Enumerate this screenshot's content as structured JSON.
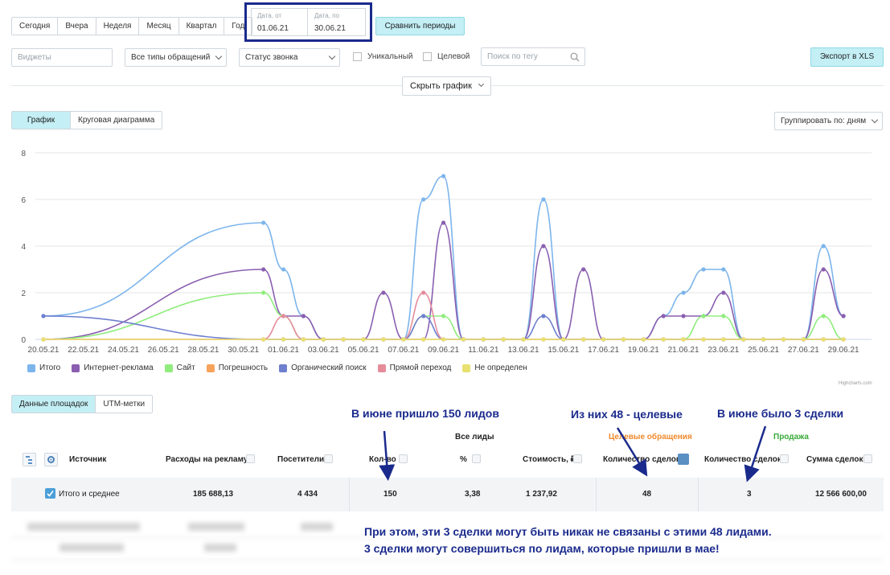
{
  "periods": [
    "Сегодня",
    "Вчера",
    "Неделя",
    "Месяц",
    "Квартал",
    "Год"
  ],
  "date_from": {
    "label": "Дата, от",
    "value": "01.06.21"
  },
  "date_to": {
    "label": "Дата, по",
    "value": "30.06.21"
  },
  "compare_label": "Сравнить периоды",
  "filters": {
    "widgets_placeholder": "Виджеты",
    "appeal_types": "Все типы обращений",
    "call_status": "Статус звонка",
    "unique_label": "Уникальный",
    "target_label": "Целевой",
    "tag_search_placeholder": "Поиск по тегу"
  },
  "export_label": "Экспорт в XLS",
  "hide_chart_label": "Скрыть график",
  "chart_tabs": [
    "График",
    "Круговая диаграмма"
  ],
  "group_by": "Группировать по: дням",
  "chart_data": {
    "type": "line",
    "x": [
      "20.05.21",
      "31.05.21",
      "01.06.21",
      "02.06.21",
      "03.06.21",
      "04.06.21",
      "05.06.21",
      "06.06.21",
      "07.06.21",
      "08.06.21",
      "09.06.21",
      "10.06.21",
      "11.06.21",
      "12.06.21",
      "13.06.21",
      "14.06.21",
      "15.06.21",
      "16.06.21",
      "17.06.21",
      "18.06.21",
      "19.06.21",
      "20.06.21",
      "21.06.21",
      "22.06.21",
      "23.06.21",
      "24.06.21",
      "25.06.21",
      "26.06.21",
      "27.06.21",
      "28.06.21",
      "29.06.21",
      "30.06.21"
    ],
    "x_tick_labels": [
      "20.05.21",
      "22.05.21",
      "24.05.21",
      "26.05.21",
      "28.05.21",
      "30.05.21",
      "01.06.21",
      "03.06.21",
      "05.06.21",
      "07.06.21",
      "09.06.21",
      "11.06.21",
      "13.06.21",
      "15.06.21",
      "17.06.21",
      "19.06.21",
      "21.06.21",
      "23.06.21",
      "25.06.21",
      "27.06.21",
      "29.06.21"
    ],
    "ylim": [
      0,
      8
    ],
    "yticks": [
      0,
      2,
      4,
      6,
      8
    ],
    "grid": true,
    "legend_placement": "bottom-left",
    "series": [
      {
        "name": "Итого",
        "color": "#7cb5ec",
        "values": [
          1,
          5,
          3,
          1,
          0,
          0,
          0,
          0,
          0,
          6,
          7,
          0,
          0,
          0,
          0,
          6,
          0,
          0,
          0,
          0,
          0,
          1,
          2,
          3,
          3,
          0,
          0,
          0,
          0,
          4,
          1,
          null
        ]
      },
      {
        "name": "Интернет-реклама",
        "color": "#8a5fb0",
        "values": [
          0,
          3,
          1,
          1,
          0,
          0,
          0,
          2,
          0,
          0,
          5,
          0,
          0,
          0,
          0,
          4,
          0,
          3,
          0,
          0,
          0,
          1,
          1,
          1,
          2,
          0,
          0,
          0,
          0,
          3,
          1,
          null
        ]
      },
      {
        "name": "Сайт",
        "color": "#90ed7d",
        "values": [
          0,
          2,
          1,
          0,
          0,
          0,
          0,
          0,
          0,
          1,
          1,
          0,
          0,
          0,
          0,
          0,
          0,
          0,
          0,
          0,
          0,
          0,
          0,
          1,
          1,
          0,
          0,
          0,
          0,
          1,
          0,
          null
        ]
      },
      {
        "name": "Погрешность",
        "color": "#f7a35c",
        "values": [
          0,
          0,
          0,
          0,
          0,
          0,
          0,
          0,
          0,
          0,
          0,
          0,
          0,
          0,
          0,
          0,
          0,
          0,
          0,
          0,
          0,
          0,
          0,
          0,
          0,
          0,
          0,
          0,
          0,
          0,
          0,
          null
        ]
      },
      {
        "name": "Органический поиск",
        "color": "#6f7fcf",
        "values": [
          1,
          0,
          0,
          0,
          0,
          0,
          0,
          0,
          0,
          1,
          0,
          0,
          0,
          0,
          0,
          1,
          0,
          0,
          0,
          0,
          0,
          0,
          0,
          0,
          0,
          0,
          0,
          0,
          0,
          0,
          0,
          null
        ]
      },
      {
        "name": "Прямой переход",
        "color": "#e58c9b",
        "values": [
          0,
          0,
          1,
          0,
          0,
          0,
          0,
          0,
          0,
          2,
          0,
          0,
          0,
          0,
          0,
          0,
          0,
          0,
          0,
          0,
          0,
          0,
          0,
          0,
          0,
          0,
          0,
          0,
          0,
          0,
          0,
          null
        ]
      },
      {
        "name": "Не определен",
        "color": "#e8e170",
        "values": [
          0,
          0,
          0,
          0,
          0,
          0,
          0,
          0,
          0,
          0,
          0,
          0,
          0,
          0,
          0,
          0,
          0,
          0,
          0,
          0,
          0,
          0,
          0,
          0,
          0,
          0,
          0,
          0,
          0,
          0,
          0,
          null
        ]
      }
    ]
  },
  "credit": "Highcharts.com",
  "table_tabs": [
    "Данные площадок",
    "UTM-метки"
  ],
  "table": {
    "group_all_leads": "Все лиды",
    "group_target": "Целевые обращения",
    "group_sale": "Продажа",
    "columns": [
      "Источник",
      "Расходы на рекламу",
      "Посетители",
      "Кол-во",
      "%",
      "Стоимость, ₽",
      "Количество сделок",
      "Количество сделок",
      "Сумма сделок"
    ],
    "total_row": {
      "label": "Итого и среднее",
      "values": [
        "185 688,13",
        "4 434",
        "150",
        "3,38",
        "1 237,92",
        "48",
        "3",
        "12 566 600,00"
      ]
    }
  },
  "annotations": {
    "a1": "В июне пришло 150 лидов",
    "a2": "Из них 48 - целевые",
    "a3": "В июне было 3 сделки",
    "bottom_line1": "При этом, эти 3 сделки могут быть никак не связаны с этими 48 лидами.",
    "bottom_line2": "3 сделки могут совершиться по лидам, которые пришли в мае!"
  },
  "colors": {
    "accent": "#c3eff5",
    "annotation": "#1a2a8c"
  }
}
